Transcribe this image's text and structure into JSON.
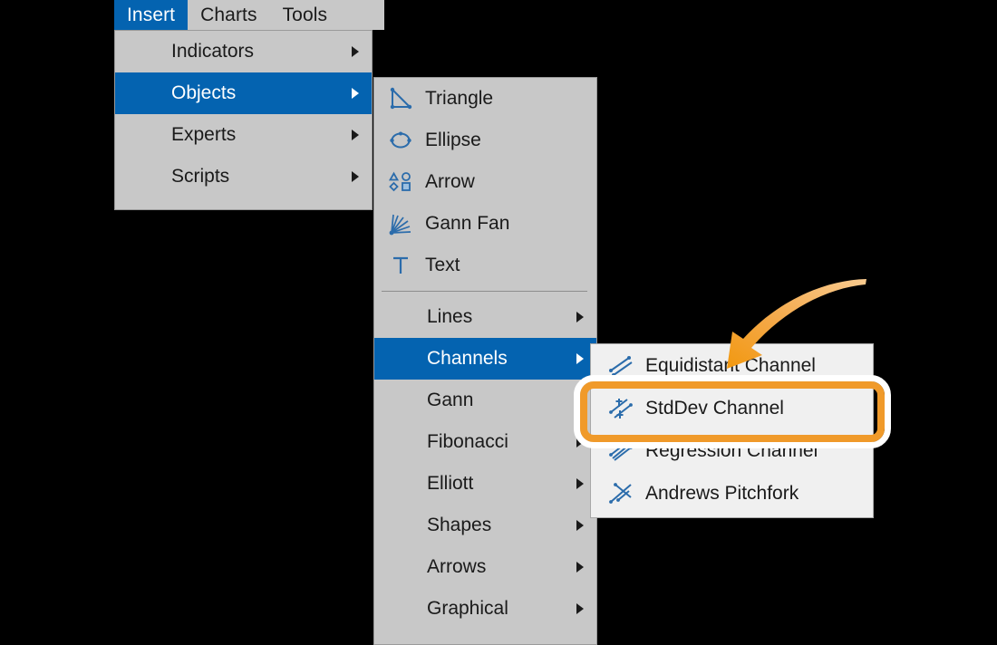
{
  "menubar": {
    "items": [
      {
        "label": "Insert",
        "active": true
      },
      {
        "label": "Charts",
        "active": false
      },
      {
        "label": "Tools",
        "active": false
      }
    ]
  },
  "insert_menu": {
    "items": [
      {
        "label": "Indicators",
        "has_submenu": true,
        "selected": false
      },
      {
        "label": "Objects",
        "has_submenu": true,
        "selected": true
      },
      {
        "label": "Experts",
        "has_submenu": true,
        "selected": false
      },
      {
        "label": "Scripts",
        "has_submenu": true,
        "selected": false
      }
    ]
  },
  "objects_menu": {
    "items": [
      {
        "label": "Triangle",
        "icon": "triangle-icon",
        "has_submenu": false,
        "selected": false
      },
      {
        "label": "Ellipse",
        "icon": "ellipse-icon",
        "has_submenu": false,
        "selected": false
      },
      {
        "label": "Arrow",
        "icon": "arrow-shapes-icon",
        "has_submenu": false,
        "selected": false
      },
      {
        "label": "Gann Fan",
        "icon": "gann-fan-icon",
        "has_submenu": false,
        "selected": false
      },
      {
        "label": "Text",
        "icon": "text-icon",
        "has_submenu": false,
        "selected": false
      }
    ],
    "submenu_items": [
      {
        "label": "Lines",
        "has_submenu": true,
        "selected": false
      },
      {
        "label": "Channels",
        "has_submenu": true,
        "selected": true
      },
      {
        "label": "Gann",
        "has_submenu": true,
        "selected": false
      },
      {
        "label": "Fibonacci",
        "has_submenu": true,
        "selected": false
      },
      {
        "label": "Elliott",
        "has_submenu": true,
        "selected": false
      },
      {
        "label": "Shapes",
        "has_submenu": true,
        "selected": false
      },
      {
        "label": "Arrows",
        "has_submenu": true,
        "selected": false
      },
      {
        "label": "Graphical",
        "has_submenu": true,
        "selected": false
      }
    ]
  },
  "channels_menu": {
    "items": [
      {
        "label": "Equidistant Channel",
        "icon": "equidistant-channel-icon"
      },
      {
        "label": "StdDev Channel",
        "icon": "stddev-channel-icon"
      },
      {
        "label": "Regression Channel",
        "icon": "regression-channel-icon"
      },
      {
        "label": "Andrews Pitchfork",
        "icon": "andrews-pitchfork-icon"
      }
    ]
  },
  "annotations": {
    "highlight_target": "StdDev Channel",
    "highlight_color": "#f09a2a",
    "highlight_outline_color": "#ffffff",
    "arrow_color": "#f2a03c"
  },
  "colors": {
    "menu_background": "#c8c8c8",
    "submenu_background": "#f0f0f0",
    "selection_blue": "#0463b0",
    "icon_blue": "#2b6cab",
    "text": "#1a1a1a",
    "page_background": "#000000"
  }
}
